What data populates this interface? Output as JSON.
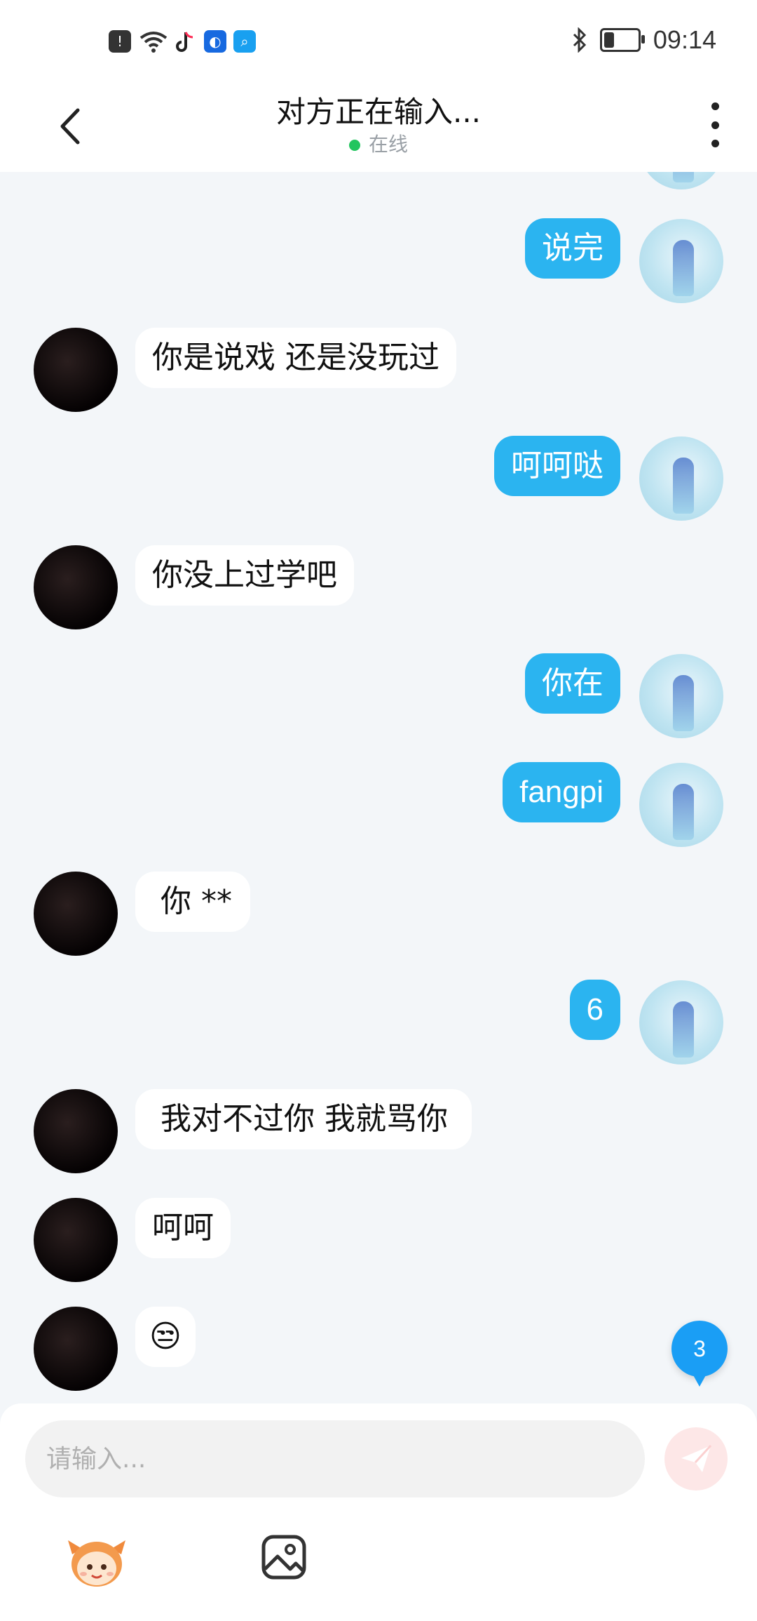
{
  "status_bar": {
    "time": "09:14",
    "icons": [
      "alert-icon",
      "wifi-icon",
      "tiktok-icon",
      "bulb-app-icon",
      "search-app-icon",
      "bluetooth-icon",
      "battery-icon"
    ]
  },
  "header": {
    "title": "对方正在输入...",
    "status": "在线"
  },
  "messages": [
    {
      "from": "me",
      "text": "说完"
    },
    {
      "from": "other",
      "text": "你是说戏 还是没玩过"
    },
    {
      "from": "me",
      "text": "呵呵哒"
    },
    {
      "from": "other",
      "text": "你没上过学吧"
    },
    {
      "from": "me",
      "text": "你在"
    },
    {
      "from": "me",
      "text": "fangpi"
    },
    {
      "from": "other",
      "text": "你 **"
    },
    {
      "from": "me",
      "text": "6"
    },
    {
      "from": "other",
      "text": "我对不过你 我就骂你"
    },
    {
      "from": "other",
      "text": "呵呵"
    },
    {
      "from": "other",
      "text": "😒"
    }
  ],
  "unread_badge": "3",
  "composer": {
    "placeholder": "请输入..."
  },
  "colors": {
    "my_bubble": "#2bb4f0",
    "other_bubble": "#ffffff",
    "background": "#f3f6f9",
    "online_dot": "#22c55e",
    "badge": "#1a9ef5"
  }
}
